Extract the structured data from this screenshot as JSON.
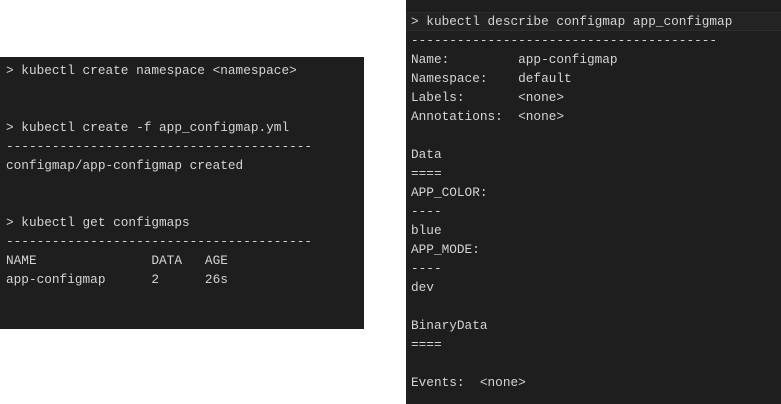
{
  "left_terminal": {
    "lines": [
      "> kubectl create namespace <namespace>",
      "",
      "",
      "> kubectl create -f app_configmap.yml",
      "----------------------------------------",
      "configmap/app-configmap created",
      "",
      "",
      "> kubectl get configmaps",
      "----------------------------------------",
      "NAME               DATA   AGE",
      "app-configmap      2      26s"
    ]
  },
  "right_terminal": {
    "lines": [
      "> kubectl describe configmap app_configmap",
      "----------------------------------------",
      "Name:         app-configmap",
      "Namespace:    default",
      "Labels:       <none>",
      "Annotations:  <none>",
      "",
      "Data",
      "====",
      "APP_COLOR:",
      "----",
      "blue",
      "APP_MODE:",
      "----",
      "dev",
      "",
      "BinaryData",
      "====",
      "",
      "Events:  <none>"
    ]
  },
  "colors": {
    "background": "#1e1e1e",
    "text": "#d4d4d4"
  }
}
